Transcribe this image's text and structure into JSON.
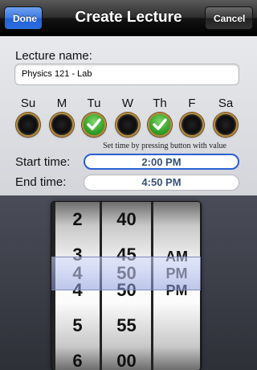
{
  "nav": {
    "title": "Create Lecture",
    "done_label": "Done",
    "cancel_label": "Cancel"
  },
  "form": {
    "lecture_name_label": "Lecture name:",
    "lecture_name_value": "Physics 121 - Lab",
    "days": [
      {
        "label": "Su",
        "checked": false
      },
      {
        "label": "M",
        "checked": false
      },
      {
        "label": "Tu",
        "checked": true
      },
      {
        "label": "W",
        "checked": false
      },
      {
        "label": "Th",
        "checked": true
      },
      {
        "label": "F",
        "checked": false
      },
      {
        "label": "Sa",
        "checked": false
      }
    ],
    "hint": "Set time by pressing button with value",
    "start_label": "Start time:",
    "start_value": "2:00 PM",
    "end_label": "End time:",
    "end_value": "4:50 PM"
  },
  "picker": {
    "hours": [
      "2",
      "3",
      "4",
      "5",
      "6"
    ],
    "minutes": [
      "40",
      "45",
      "50",
      "55",
      "00"
    ],
    "ampm": [
      "AM",
      "PM"
    ],
    "selected": {
      "hour": "4",
      "minute": "50",
      "ampm": "PM"
    }
  },
  "colors": {
    "accent": "#2a6fe0",
    "check_green": "#3aa72e",
    "time_text": "#37527a"
  }
}
